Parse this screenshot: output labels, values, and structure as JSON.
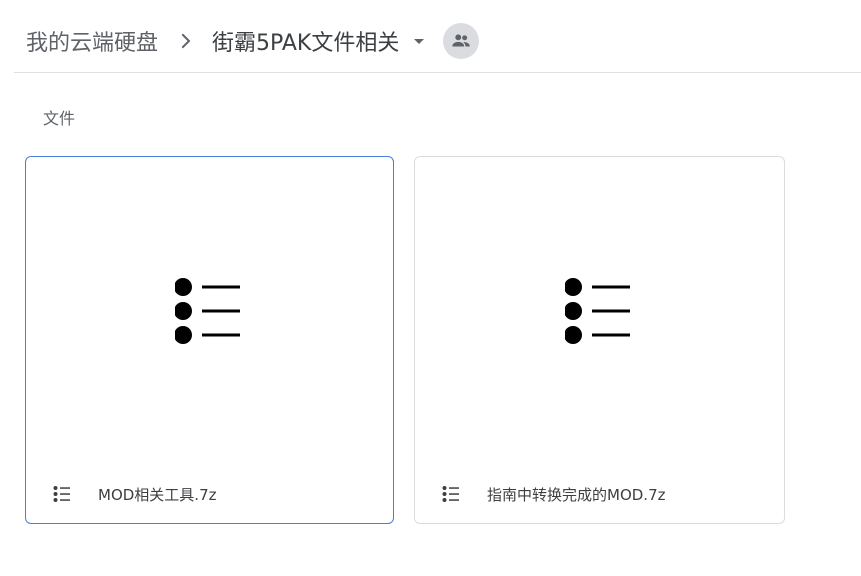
{
  "breadcrumb": {
    "root_label": "我的云端硬盘",
    "current_label": "街霸5PAK文件相关"
  },
  "section": {
    "files_title": "文件"
  },
  "files": [
    {
      "name": "MOD相关工具.7z",
      "icon": "list-file-icon",
      "selected": true
    },
    {
      "name": "指南中转换完成的MOD.7z",
      "icon": "list-file-icon",
      "selected": false
    }
  ],
  "colors": {
    "selected_border": "#4a7fd6",
    "card_border": "#dadce0",
    "avatar_bg": "#dadce0",
    "text": "#3c4043",
    "muted_text": "#5f6368"
  }
}
